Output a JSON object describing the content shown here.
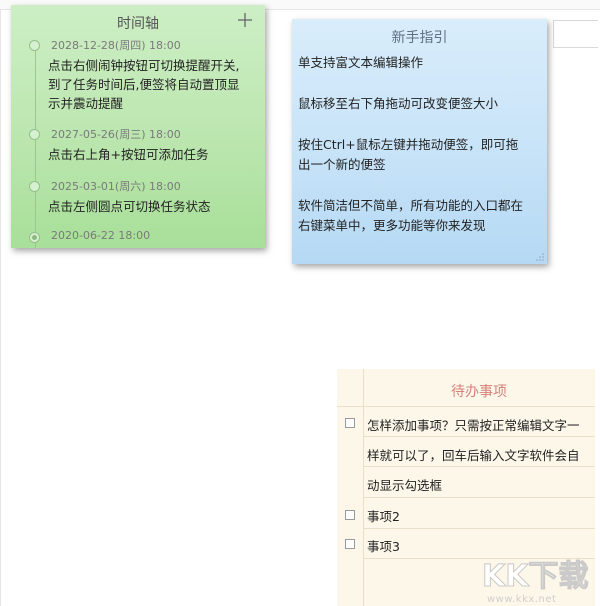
{
  "timeline_note": {
    "title": "时间轴",
    "add_icon": "plus-icon",
    "entries": [
      {
        "date": "2028-12-28(周四) 18:00",
        "lines": [
          "点击右侧闹钟按钮可切换提醒开关,",
          "到了任务时间后,便签将自动置顶显",
          "示并震动提醒"
        ],
        "done": false
      },
      {
        "date": "2027-05-26(周三) 18:00",
        "lines": [
          "点击右上角+按钮可添加任务"
        ],
        "done": false
      },
      {
        "date": "2025-03-01(周六) 18:00",
        "lines": [
          "点击左侧圆点可切换任务状态"
        ],
        "done": false
      },
      {
        "date": "2020-06-22 18:00",
        "lines": [],
        "done": true
      }
    ]
  },
  "guide_note": {
    "title": "新手指引",
    "lines": [
      "单支持富文本编辑操作",
      "",
      "鼠标移至右下角拖动可改变便签大小",
      "",
      "按住Ctrl+鼠标左键并拖动便签，即可拖",
      "出一个新的便签",
      "",
      "软件简洁但不简单，所有功能的入口都在",
      "右键菜单中，更多功能等你来发现"
    ]
  },
  "todo_note": {
    "title": "待办事项",
    "rows": [
      {
        "text": "怎样添加事项？只需按正常编辑文字一",
        "checkbox": true
      },
      {
        "text": "样就可以了，回车后输入文字软件会自",
        "checkbox": false
      },
      {
        "text": "动显示勾选框",
        "checkbox": false
      },
      {
        "text": "事项2",
        "checkbox": true
      },
      {
        "text": "事项3",
        "checkbox": true
      }
    ]
  },
  "watermark": {
    "logo_text": "KK下载",
    "url": "www.kkx.net"
  },
  "colors": {
    "timeline_bg": "#bde7b1",
    "guide_bg": "#c9e4f8",
    "todo_bg": "#fdf7ea",
    "todo_title": "#d7807a"
  }
}
